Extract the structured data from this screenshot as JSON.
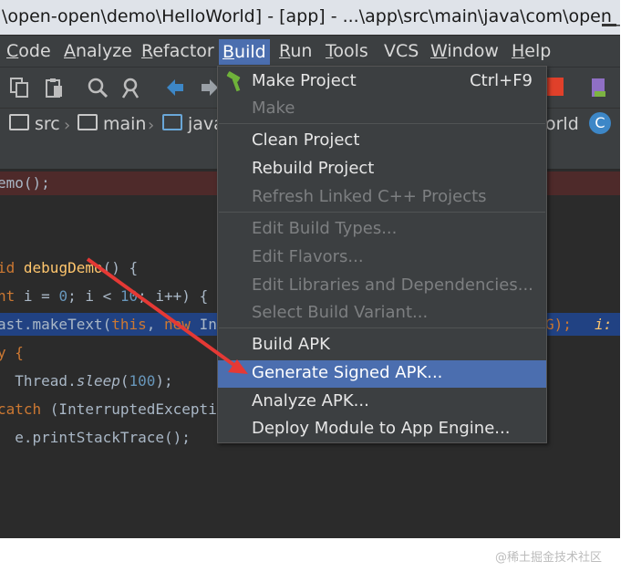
{
  "window": {
    "title": "\\open-open\\demo\\HelloWorld] - [app] - ...\\app\\src\\main\\java\\com\\open_..."
  },
  "menubar": {
    "items": [
      {
        "label": "Code",
        "mnemonic": "C",
        "rest": "ode"
      },
      {
        "label": "Analyze",
        "mnemonic": "A",
        "rest": "nalyze"
      },
      {
        "label": "Refactor",
        "mnemonic": "R",
        "rest": "efactor"
      },
      {
        "label": "Build",
        "mnemonic": "B",
        "rest": "uild"
      },
      {
        "label": "Run",
        "mnemonic": "R",
        "rest": "un"
      },
      {
        "label": "Tools",
        "mnemonic": "T",
        "rest": "ools"
      },
      {
        "label": "VCS",
        "mnemonic": "",
        "rest": "VCS"
      },
      {
        "label": "Window",
        "mnemonic": "W",
        "rest": "indow"
      },
      {
        "label": "Help",
        "mnemonic": "H",
        "rest": "elp"
      }
    ]
  },
  "toolbar": {
    "icons": [
      "copy-icon",
      "paste-icon",
      "find-icon",
      "find-replace-icon",
      "back-icon",
      "forward-icon",
      "stop-icon",
      "device-manager-icon"
    ],
    "stop_color": "#e0402a"
  },
  "breadcrumb": {
    "items": [
      "src",
      "main",
      "java"
    ],
    "tail": "orld",
    "class_badge": "C"
  },
  "editor": {
    "lines": [
      {
        "parts": [
          {
            "t": "emo();",
            "c": ""
          }
        ]
      },
      {
        "parts": []
      },
      {
        "parts": [
          {
            "t": "id ",
            "c": "kw"
          },
          {
            "t": "debugDemo",
            "c": "fn"
          },
          {
            "t": "() {",
            "c": ""
          }
        ]
      },
      {
        "parts": [
          {
            "t": "nt ",
            "c": "kw"
          },
          {
            "t": "i = ",
            "c": ""
          },
          {
            "t": "0",
            "c": "num"
          },
          {
            "t": "; i < ",
            "c": ""
          },
          {
            "t": "10",
            "c": "num"
          },
          {
            "t": "; i++) {",
            "c": ""
          }
        ]
      },
      {
        "parts": [
          {
            "t": "ast.makeText(",
            "c": ""
          },
          {
            "t": "this",
            "c": "kw"
          },
          {
            "t": ", ",
            "c": ""
          },
          {
            "t": "new ",
            "c": "kw"
          },
          {
            "t": "In",
            "c": ""
          }
        ]
      },
      {
        "parts": [
          {
            "t": "y {",
            "c": "kw"
          }
        ]
      },
      {
        "parts": [
          {
            "t": "  Thread.",
            "c": ""
          },
          {
            "t": "sleep",
            "c": "it"
          },
          {
            "t": "(",
            "c": ""
          },
          {
            "t": "100",
            "c": "num"
          },
          {
            "t": ");",
            "c": ""
          }
        ]
      },
      {
        "parts": [
          {
            "t": "catch ",
            "c": "kw"
          },
          {
            "t": "(InterruptedExcepti",
            "c": ""
          }
        ]
      },
      {
        "parts": [
          {
            "t": "  e.printStackTrace();",
            "c": ""
          }
        ]
      }
    ],
    "sel_tail_1": "G);",
    "sel_tail_2": "i:"
  },
  "build_menu": {
    "items": [
      {
        "label": "Make Project",
        "shortcut": "Ctrl+F9",
        "enabled": true,
        "icon": "hammer-icon"
      },
      {
        "label": "Make",
        "shortcut": "",
        "enabled": false
      },
      {
        "label": "Clean Project",
        "shortcut": "",
        "enabled": true
      },
      {
        "label": "Rebuild Project",
        "shortcut": "",
        "enabled": true
      },
      {
        "label": "Refresh Linked C++ Projects",
        "shortcut": "",
        "enabled": false
      },
      {
        "label": "Edit Build Types...",
        "shortcut": "",
        "enabled": false
      },
      {
        "label": "Edit Flavors...",
        "shortcut": "",
        "enabled": false
      },
      {
        "label": "Edit Libraries and Dependencies...",
        "shortcut": "",
        "enabled": false
      },
      {
        "label": "Select Build Variant...",
        "shortcut": "",
        "enabled": false
      },
      {
        "label": "Build APK",
        "shortcut": "",
        "enabled": true
      },
      {
        "label": "Generate Signed APK...",
        "shortcut": "",
        "enabled": true,
        "highlighted": true
      },
      {
        "label": "Analyze APK...",
        "shortcut": "",
        "enabled": true
      },
      {
        "label": "Deploy Module to App Engine...",
        "shortcut": "",
        "enabled": true
      }
    ]
  },
  "annotation": {
    "arrow_color": "#e53935"
  },
  "watermark": "@稀土掘金技术社区"
}
